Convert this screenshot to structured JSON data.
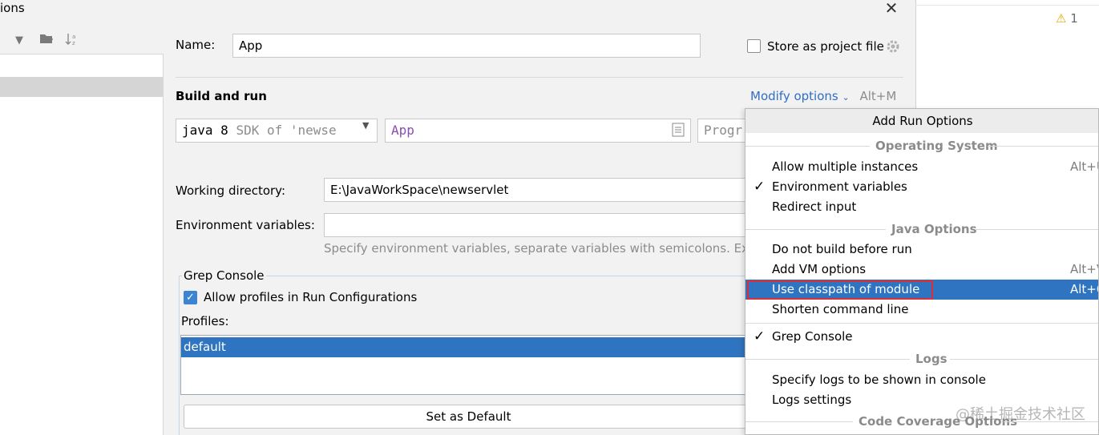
{
  "window": {
    "title_fragment": "ions",
    "close_glyph": "✕"
  },
  "right_pane": {
    "warning_count": "1"
  },
  "form": {
    "name_label": "Name:",
    "name_value": "App",
    "store_label": "Store as project file",
    "build_run": "Build and run",
    "modify_options": "Modify options",
    "modify_shortcut": "Alt+M",
    "sdk_value": "java 8",
    "sdk_suffix": "SDK of 'newse",
    "main_class": "App",
    "program_args_placeholder": "Progr",
    "working_dir_label": "Working directory:",
    "working_dir_value": "E:\\JavaWorkSpace\\newservlet",
    "env_label": "Environment variables:",
    "env_hint": "Specify environment variables, separate variables with semicolons. Exam"
  },
  "grep": {
    "title": "Grep Console",
    "allow_profiles": "Allow profiles in Run Configurations",
    "profiles_label": "Profiles:",
    "profiles": [
      "default"
    ],
    "set_default": "Set as Default"
  },
  "popup": {
    "header": "Add Run Options",
    "groups": {
      "os": "Operating System",
      "java": "Java Options",
      "logs": "Logs",
      "coverage": "Code Coverage Options"
    },
    "items": [
      {
        "label": "Allow multiple instances",
        "shortcut": "Alt+U",
        "checked": false
      },
      {
        "label": "Environment variables",
        "shortcut": "",
        "checked": true
      },
      {
        "label": "Redirect input",
        "shortcut": "",
        "checked": false
      },
      {
        "label": "Do not build before run",
        "shortcut": "",
        "checked": false
      },
      {
        "label": "Add VM options",
        "shortcut": "Alt+V",
        "checked": false
      },
      {
        "label": "Use classpath of module",
        "shortcut": "Alt+O",
        "checked": false,
        "selected": true
      },
      {
        "label": "Shorten command line",
        "shortcut": "",
        "checked": false
      },
      {
        "label": "Grep Console",
        "shortcut": "",
        "checked": true
      },
      {
        "label": "Specify logs to be shown in console",
        "shortcut": "",
        "checked": false
      },
      {
        "label": "Logs settings",
        "shortcut": "",
        "checked": false
      }
    ]
  },
  "watermark": "@稀土掘金技术社区",
  "colors": {
    "accent": "#2f74c0",
    "highlight_border": "#d6303a",
    "link": "#2f6ec5"
  }
}
